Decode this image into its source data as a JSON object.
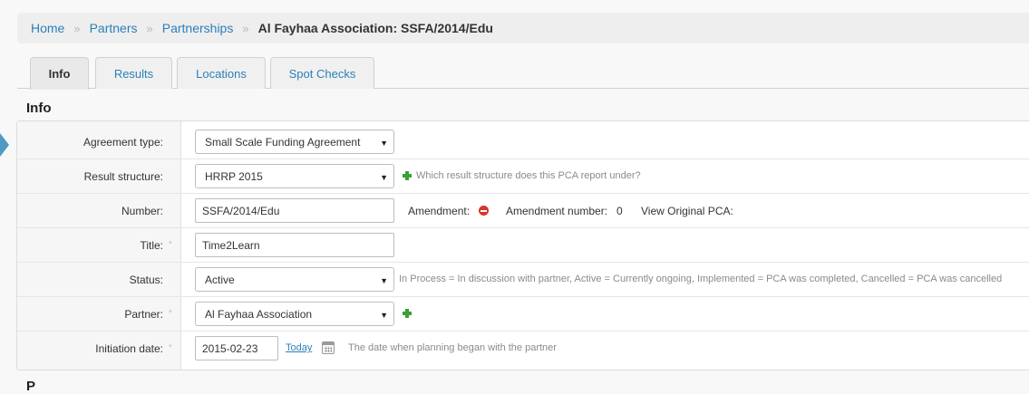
{
  "breadcrumb": {
    "home": "Home",
    "partners": "Partners",
    "partnerships": "Partnerships",
    "current": "Al Fayhaa Association: SSFA/2014/Edu",
    "separator": "»"
  },
  "tabs": [
    "Info",
    "Results",
    "Locations",
    "Spot Checks"
  ],
  "section_title": "Info",
  "next_section_peek": "P",
  "form": {
    "agreement_type": {
      "label": "Agreement type:",
      "value": "Small Scale Funding Agreement"
    },
    "result_structure": {
      "label": "Result structure:",
      "value": "HRRP 2015",
      "help": "Which result structure does this PCA report under?"
    },
    "number": {
      "label": "Number:",
      "value": "SSFA/2014/Edu",
      "amendment_label": "Amendment:",
      "amendment_number_label": "Amendment number:",
      "amendment_number": "0",
      "view_original_label": "View Original PCA:"
    },
    "title": {
      "label": "Title:",
      "value": "Time2Learn",
      "required": "*"
    },
    "status": {
      "label": "Status:",
      "value": "Active",
      "help": "In Process = In discussion with partner, Active = Currently ongoing, Implemented = PCA was completed, Cancelled = PCA was cancelled"
    },
    "partner": {
      "label": "Partner:",
      "value": "Al Fayhaa Association",
      "required": "*"
    },
    "initiation_date": {
      "label": "Initiation date:",
      "value": "2015-02-23",
      "required": "*",
      "today_link": "Today",
      "help": "The date when planning began with the partner"
    }
  },
  "icons": {
    "add": "plus-icon",
    "remove": "minus-circle-icon",
    "calendar": "calendar-icon",
    "dropdown": "caret-down-icon"
  },
  "colors": {
    "link": "#2a80b9",
    "add_green": "#3aa03a",
    "remove_red": "#d9342b",
    "side_arrow": "#4f9bc2"
  }
}
